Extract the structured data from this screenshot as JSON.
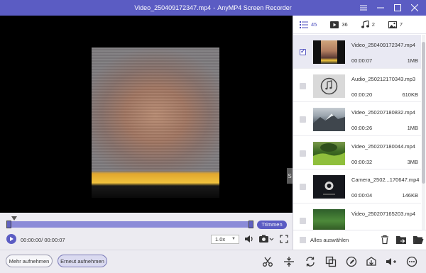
{
  "window": {
    "file_title": "Video_250409172347.mp4",
    "separator": "-",
    "app_name": "AnyMP4 Screen Recorder"
  },
  "player": {
    "side_tab_label": "S",
    "trim_label": "Trimmen",
    "time_readout": "00:00:00/ 00:00:07",
    "speed": "1.0x",
    "progress": 0.0
  },
  "tabs": [
    {
      "icon": "list-icon",
      "count": "45"
    },
    {
      "icon": "video-icon",
      "count": "36"
    },
    {
      "icon": "music-icon",
      "count": "2"
    },
    {
      "icon": "image-icon",
      "count": "7"
    }
  ],
  "files": [
    {
      "name": "Video_250409172347.mp4",
      "duration": "00:00:07",
      "size": "1MB",
      "selected": true,
      "thumb": "portrait"
    },
    {
      "name": "Audio_250212170343.mp3",
      "duration": "00:00:20",
      "size": "610KB",
      "selected": false,
      "thumb": "audio"
    },
    {
      "name": "Video_250207180832.mp4",
      "duration": "00:00:26",
      "size": "1MB",
      "selected": false,
      "thumb": "mountain"
    },
    {
      "name": "Video_250207180044.mp4",
      "duration": "00:00:32",
      "size": "3MB",
      "selected": false,
      "thumb": "landscape"
    },
    {
      "name": "Camera_2502...170647.mp4",
      "duration": "00:00:04",
      "size": "146KB",
      "selected": false,
      "thumb": "camera"
    },
    {
      "name": "Video_250207165203.mp4",
      "duration": "",
      "size": "",
      "selected": false,
      "thumb": "green"
    }
  ],
  "panel_footer": {
    "select_all_label": "Alles auswählen"
  },
  "bottom": {
    "record_more_label": "Mehr aufnehmen",
    "record_again_label": "Erneut aufnehmen"
  },
  "colors": {
    "accent": "#5b5cc3"
  }
}
